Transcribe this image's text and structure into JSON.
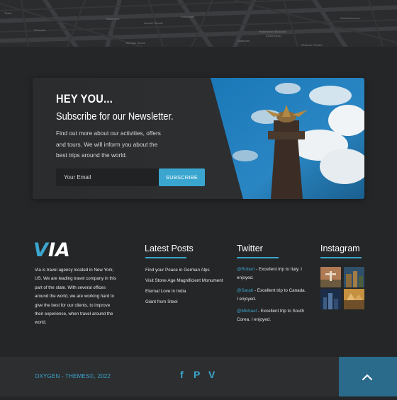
{
  "map": {
    "labels": [
      "Teatro",
      "Wertheimer",
      "Eldorado",
      "Bauernhof",
      "Kunsthalle",
      "Zentral Theater",
      "Bishops House",
      "Grand Theater",
      "Ludwigsplatz",
      "Stadtpark",
      "Augustiner Bräu",
      "Historisches Museum",
      "Kunst Archiv",
      "Neuer Garten",
      "Zentrum Theatre",
      "Heimatmuseum"
    ]
  },
  "newsletter": {
    "heading": "HEY YOU...",
    "title": "Subscribe for our Newsletter.",
    "description": "Find out more about our activities, offers and tours. We will inform you about the best trips around the world.",
    "email_placeholder": "Your Email",
    "subscribe_label": "SUBSCRIBE"
  },
  "about": {
    "logo": "VIA",
    "text": "Via is travel agency located in New York, US. We are leading travel company in this part of the state. With several offices around the world, we are working hard to give the best for our clients, to improve their experience, when travel around the world."
  },
  "latest_posts": {
    "title": "Latest Posts",
    "items": [
      "Find your Peace in German Alps",
      "Visit Stone Age Magnificient Monument",
      "Eternal Love in India",
      "Giant from Steel"
    ]
  },
  "twitter": {
    "title": "Twitter",
    "tweets": [
      {
        "handle": "@Robert",
        "text": " - Excellent trip to Italy. I enjoyed."
      },
      {
        "handle": "@Sarah",
        "text": " - Excellent trip to Canada. I enjoyed."
      },
      {
        "handle": "@Michael",
        "text": " - Excellent trip to South Corea. I enjoyed."
      }
    ]
  },
  "instagram": {
    "title": "Instagram"
  },
  "footer": {
    "copyright": "OXYGEN - THEMES©, 2022",
    "social": [
      "f",
      "P",
      "V"
    ]
  },
  "colors": {
    "accent": "#3aa6cf",
    "background": "#252627",
    "bottom_bar": "#2d2e30",
    "scroll_top": "#2a6b8c"
  },
  "icons": [
    "facebook-icon",
    "pinterest-icon",
    "vimeo-icon",
    "chevron-up-icon"
  ]
}
